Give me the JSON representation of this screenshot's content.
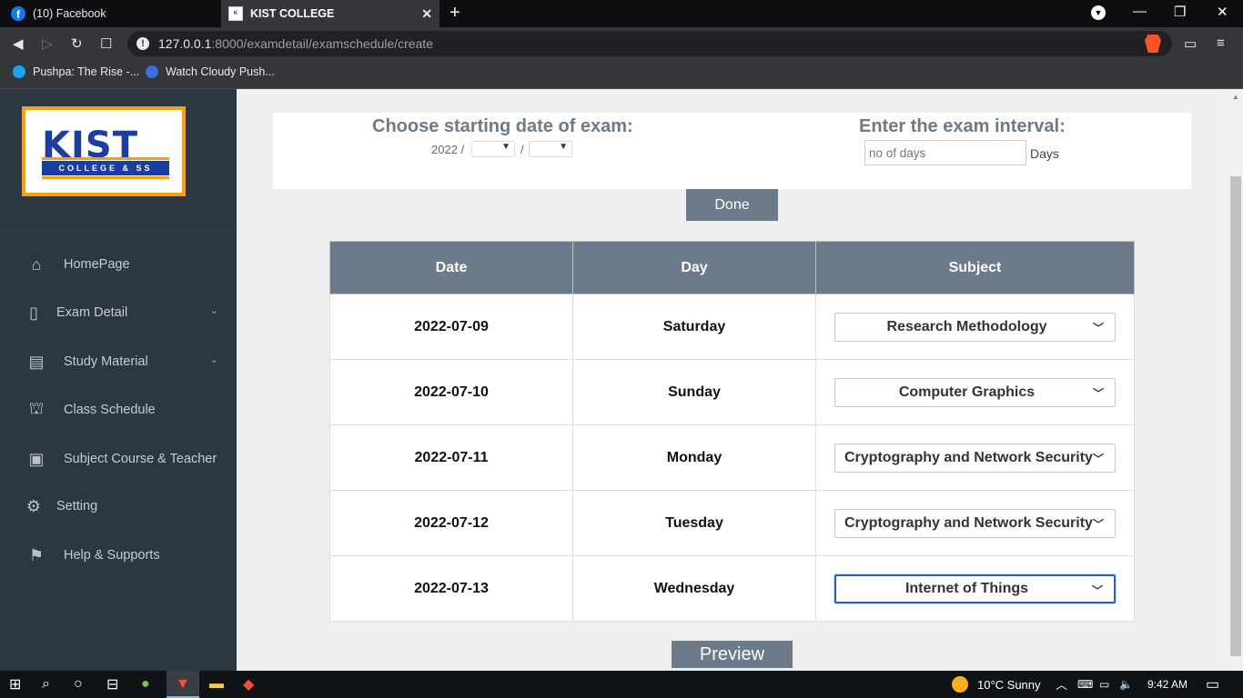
{
  "browser": {
    "tabs": [
      {
        "label": "(10) Facebook",
        "active": false
      },
      {
        "label": "KIST COLLEGE",
        "active": true
      }
    ],
    "url_host": "127.0.0.1",
    "url_path": ":8000/examdetail/examschedule/create",
    "bookmarks": [
      {
        "label": "Pushpa: The Rise -..."
      },
      {
        "label": "Watch Cloudy Push..."
      }
    ]
  },
  "sidebar": {
    "logo_title": "KIST",
    "logo_subtitle": "COLLEGE & SS",
    "items": [
      {
        "label": "HomePage",
        "icon": "home-icon"
      },
      {
        "label": "Exam Detail",
        "icon": "book-icon",
        "has_submenu": true
      },
      {
        "label": "Study Material",
        "icon": "notebook-icon",
        "has_submenu": true
      },
      {
        "label": "Class Schedule",
        "icon": "school-icon"
      },
      {
        "label": "Subject Course & Teacher",
        "icon": "calendar-check-icon"
      },
      {
        "label": "Setting",
        "icon": "gear-icon"
      },
      {
        "label": "Help & Supports",
        "icon": "flag-icon"
      }
    ]
  },
  "form": {
    "start_date_label": "Choose starting date of exam:",
    "year_prefix": "2022 /",
    "separator": "/",
    "interval_label": "Enter the exam interval:",
    "interval_placeholder": "no of days",
    "interval_unit": "Days",
    "done_label": "Done",
    "preview_label": "Preview"
  },
  "schedule": {
    "headers": [
      "Date",
      "Day",
      "Subject"
    ],
    "rows": [
      {
        "date": "2022-07-09",
        "day": "Saturday",
        "subject": "Research Methodology"
      },
      {
        "date": "2022-07-10",
        "day": "Sunday",
        "subject": "Computer Graphics"
      },
      {
        "date": "2022-07-11",
        "day": "Monday",
        "subject": "Cryptography and Network Security"
      },
      {
        "date": "2022-07-12",
        "day": "Tuesday",
        "subject": "Cryptography and Network Security"
      },
      {
        "date": "2022-07-13",
        "day": "Wednesday",
        "subject": "Internet of Things"
      }
    ]
  },
  "taskbar": {
    "weather": "10°C  Sunny",
    "time": "9:42 AM"
  },
  "colors": {
    "sidebar_bg": "#2c3742",
    "accent": "#6c7a89",
    "logo_border": "#f7a10a",
    "logo_blue": "#1a3fa0"
  }
}
